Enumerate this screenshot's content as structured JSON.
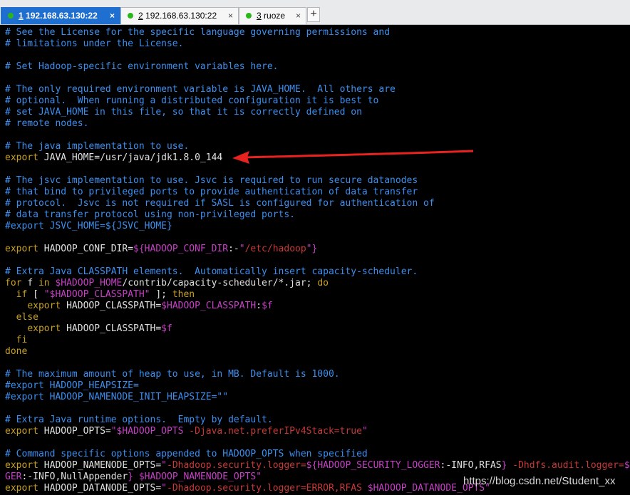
{
  "tabs": [
    {
      "num": "1",
      "label": " 192.168.63.130:22",
      "active": true
    },
    {
      "num": "2",
      "label": " 192.168.63.130:22",
      "active": false
    },
    {
      "num": "3",
      "label": " ruoze",
      "active": false
    }
  ],
  "close_glyph": "×",
  "newtab_glyph": "+",
  "lines": [
    [
      [
        "c",
        "# See the License for the specific language governing permissions and"
      ]
    ],
    [
      [
        "c",
        "# limitations under the License."
      ]
    ],
    [],
    [
      [
        "c",
        "# Set Hadoop-specific environment variables here."
      ]
    ],
    [],
    [
      [
        "c",
        "# The only required environment variable is JAVA_HOME.  All others are"
      ]
    ],
    [
      [
        "c",
        "# optional.  When running a distributed configuration it is best to"
      ]
    ],
    [
      [
        "c",
        "# set JAVA_HOME in this file, so that it is correctly defined on"
      ]
    ],
    [
      [
        "c",
        "# remote nodes."
      ]
    ],
    [],
    [
      [
        "c",
        "# The java implementation to use."
      ]
    ],
    [
      [
        "k",
        "export "
      ],
      [
        "w",
        "JAVA_HOME=/usr/java/jdk1.8.0_144"
      ]
    ],
    [],
    [
      [
        "c",
        "# The jsvc implementation to use. Jsvc is required to run secure datanodes"
      ]
    ],
    [
      [
        "c",
        "# that bind to privileged ports to provide authentication of data transfer"
      ]
    ],
    [
      [
        "c",
        "# protocol.  Jsvc is not required if SASL is configured for authentication of"
      ]
    ],
    [
      [
        "c",
        "# data transfer protocol using non-privileged ports."
      ]
    ],
    [
      [
        "c",
        "#export JSVC_HOME=${JSVC_HOME}"
      ]
    ],
    [],
    [
      [
        "k",
        "export "
      ],
      [
        "w",
        "HADOOP_CONF_DIR="
      ],
      [
        "v",
        "${HADOOP_CONF_DIR"
      ],
      [
        "w",
        ":-"
      ],
      [
        "v",
        "\""
      ],
      [
        "s",
        "/etc/hadoop"
      ],
      [
        "v",
        "\"}"
      ]
    ],
    [],
    [
      [
        "c",
        "# Extra Java CLASSPATH elements.  Automatically insert capacity-scheduler."
      ]
    ],
    [
      [
        "k",
        "for "
      ],
      [
        "w",
        "f "
      ],
      [
        "k",
        "in "
      ],
      [
        "v",
        "$HADOOP_HOME"
      ],
      [
        "w",
        "/contrib/capacity-scheduler/*.jar; "
      ],
      [
        "k",
        "do"
      ]
    ],
    [
      [
        "w",
        "  "
      ],
      [
        "k",
        "if "
      ],
      [
        "w",
        "[ "
      ],
      [
        "v",
        "\"$HADOOP_CLASSPATH\""
      ],
      [
        "w",
        " ]; "
      ],
      [
        "k",
        "then"
      ]
    ],
    [
      [
        "w",
        "    "
      ],
      [
        "k",
        "export "
      ],
      [
        "w",
        "HADOOP_CLASSPATH="
      ],
      [
        "v",
        "$HADOOP_CLASSPATH"
      ],
      [
        "w",
        ":"
      ],
      [
        "v",
        "$f"
      ]
    ],
    [
      [
        "w",
        "  "
      ],
      [
        "k",
        "else"
      ]
    ],
    [
      [
        "w",
        "    "
      ],
      [
        "k",
        "export "
      ],
      [
        "w",
        "HADOOP_CLASSPATH="
      ],
      [
        "v",
        "$f"
      ]
    ],
    [
      [
        "w",
        "  "
      ],
      [
        "k",
        "fi"
      ]
    ],
    [
      [
        "k",
        "done"
      ]
    ],
    [],
    [
      [
        "c",
        "# The maximum amount of heap to use, in MB. Default is 1000."
      ]
    ],
    [
      [
        "c",
        "#export HADOOP_HEAPSIZE="
      ]
    ],
    [
      [
        "c",
        "#export HADOOP_NAMENODE_INIT_HEAPSIZE=\"\""
      ]
    ],
    [],
    [
      [
        "c",
        "# Extra Java runtime options.  Empty by default."
      ]
    ],
    [
      [
        "k",
        "export "
      ],
      [
        "w",
        "HADOOP_OPTS="
      ],
      [
        "v",
        "\"$HADOOP_OPTS "
      ],
      [
        "s",
        "-Djava.net.preferIPv4Stack=true"
      ],
      [
        "v",
        "\""
      ]
    ],
    [],
    [
      [
        "c",
        "# Command specific options appended to HADOOP_OPTS when specified"
      ]
    ],
    [
      [
        "k",
        "export "
      ],
      [
        "w",
        "HADOOP_NAMENODE_OPTS="
      ],
      [
        "v",
        "\""
      ],
      [
        "s",
        "-Dhadoop.security.logger="
      ],
      [
        "v",
        "${HADOOP_SECURITY_LOGGER"
      ],
      [
        "w",
        ":-INFO,RFAS"
      ],
      [
        "v",
        "} "
      ],
      [
        "s",
        "-Dhdfs.audit.logger="
      ],
      [
        "v",
        "${HDFS_AUDIT_LOG"
      ]
    ],
    [
      [
        "v",
        "GER"
      ],
      [
        "w",
        ":-INFO,NullAppender"
      ],
      [
        "v",
        "} $HADOOP_NAMENODE_OPTS\""
      ]
    ],
    [
      [
        "k",
        "export "
      ],
      [
        "w",
        "HADOOP_DATANODE_OPTS="
      ],
      [
        "v",
        "\""
      ],
      [
        "s",
        "-Dhadoop.security.logger=ERROR,RFAS "
      ],
      [
        "v",
        "$HADOOP_DATANODE_OPTS\""
      ]
    ]
  ],
  "watermark": "https://blog.csdn.net/Student_xx",
  "colors": {
    "comment": "#3b8ff0",
    "keyword": "#c8a020",
    "variable": "#c83fc8",
    "string": "#c83838",
    "arrow": "#e8231f",
    "active_tab": "#1f6fd1"
  }
}
